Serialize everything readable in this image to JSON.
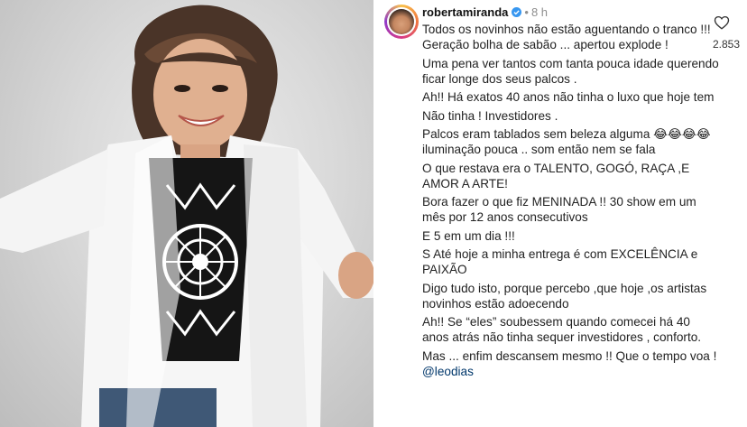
{
  "post": {
    "username": "robertamiranda",
    "time": "8 h",
    "like_count": "2.853"
  },
  "caption": {
    "paragraphs": [
      "Todos os novinhos não estão aguentando o tranco !!! Geração bolha de sabão ... apertou explode !",
      "Uma pena ver tantos com tanta pouca idade querendo ficar longe dos seus palcos .",
      "Ah!! Há exatos 40 anos não tinha o luxo que hoje tem",
      "Não tinha ! Investidores .",
      " Palcos eram tablados sem beleza alguma 😂😂😂😂 iluminação pouca .. som então nem se fala",
      "O que restava era o TALENTO, GOGÓ, RAÇA ,E AMOR A ARTE!",
      "Bora fazer o que fiz MENINADA !! 30 show em um mês por 12 anos consecutivos",
      "E 5 em um dia !!!",
      "S Até hoje a minha entrega é com EXCELÊNCIA e PAIXÃO",
      "Digo tudo isto, porque percebo ,que hoje ,os artistas novinhos estão adoecendo",
      "Ah!! Se “eles” soubessem quando comecei há 40 anos atrás não tinha sequer investidores , conforto."
    ],
    "last_text": "Mas ... enfim descansem mesmo !! Que o tempo voa ! ",
    "mention": "@leodias"
  },
  "icons": {
    "verified": "verified-badge-icon",
    "like": "heart-outline-icon"
  },
  "colors": {
    "verified": "#3897f0",
    "mention": "#00376b",
    "text": "#222222",
    "muted": "#8e8e8e"
  }
}
